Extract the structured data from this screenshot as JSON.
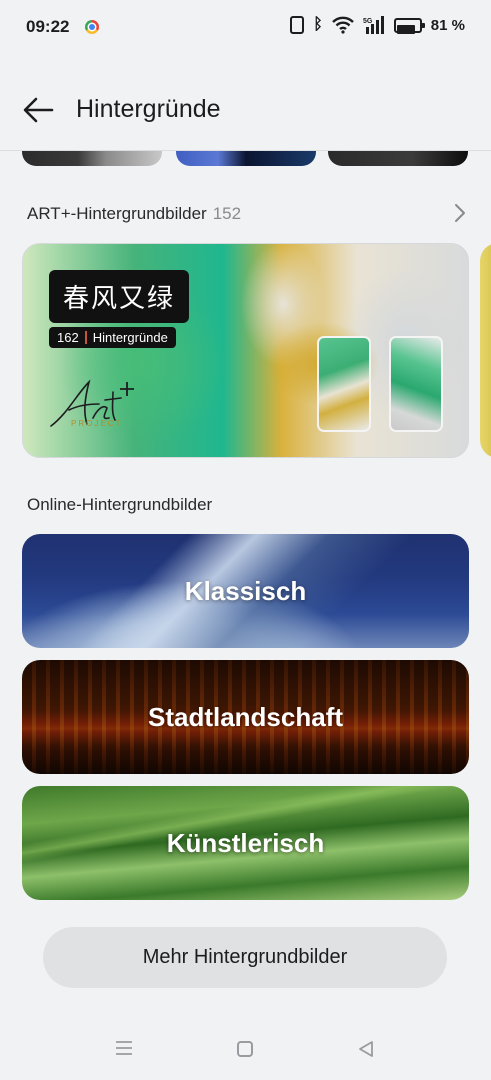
{
  "status_bar": {
    "time": "09:22",
    "network": "5G",
    "battery_percent_label": "81 %",
    "battery_level": 0.81
  },
  "header": {
    "title": "Hintergründe"
  },
  "art_section": {
    "heading": "ART+-Hintergrundbilder",
    "count": "152",
    "card": {
      "title": "春风又绿",
      "sub_count": "162",
      "sub_label": "Hintergründe",
      "logo_word": "PROJECT"
    }
  },
  "online_section": {
    "heading": "Online-Hintergrundbilder",
    "categories": [
      {
        "label": "Klassisch"
      },
      {
        "label": "Stadtlandschaft"
      },
      {
        "label": "Künstlerisch"
      }
    ]
  },
  "more_button": {
    "label": "Mehr Hintergrundbilder"
  },
  "icons": {
    "back": "arrow-left-icon",
    "chevron": "chevron-right-icon",
    "nav_menu": "menu-icon",
    "nav_home": "home-square-icon",
    "nav_back": "triangle-back-icon"
  }
}
